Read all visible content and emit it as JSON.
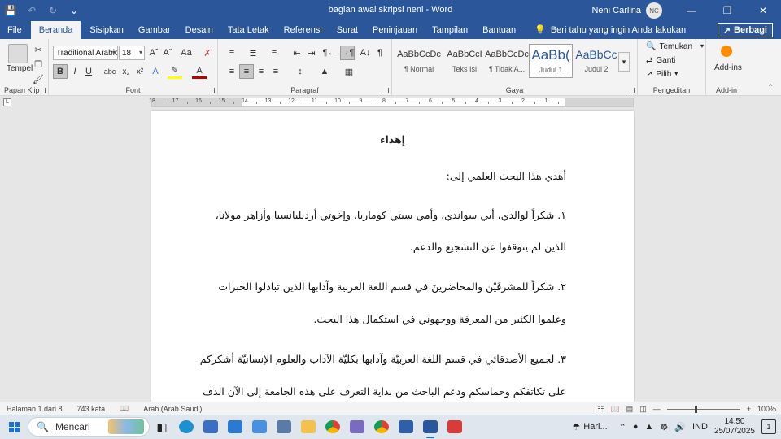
{
  "titlebar": {
    "doc_title": "bagian awal skripsi neni - Word",
    "user_name": "Neni Carlina",
    "avatar_initials": "NC"
  },
  "tabs": [
    "File",
    "Beranda",
    "Sisipkan",
    "Gambar",
    "Desain",
    "Tata Letak",
    "Referensi",
    "Surat",
    "Peninjauan",
    "Tampilan",
    "Bantuan"
  ],
  "tell_me": "Beri tahu yang ingin Anda lakukan",
  "share_label": "Berbagi",
  "ribbon": {
    "clipboard": {
      "paste_label": "Tempel",
      "group_label": "Papan Klip"
    },
    "font": {
      "font_name": "Traditional Arabic",
      "font_size": "18",
      "group_label": "Font"
    },
    "paragraph": {
      "group_label": "Paragraf"
    },
    "styles": {
      "group_label": "Gaya",
      "items": [
        {
          "sample": "AaBbCcDc",
          "name": "¶ Normal"
        },
        {
          "sample": "AaBbCcI",
          "name": "Teks Isi"
        },
        {
          "sample": "AaBbCcDc",
          "name": "¶ Tidak A..."
        },
        {
          "sample": "AaBb(",
          "name": "Judul 1"
        },
        {
          "sample": "AaBbCc",
          "name": "Judul 2"
        }
      ]
    },
    "editing": {
      "find": "Temukan",
      "replace": "Ganti",
      "select": "Pilih",
      "group_label": "Pengeditan"
    },
    "addins": {
      "label": "Add-ins",
      "group_label": "Add-in"
    }
  },
  "ruler": {
    "numbers": [
      "18",
      "17",
      "16",
      "15",
      "14",
      "13",
      "12",
      "11",
      "10",
      "9",
      "8",
      "7",
      "6",
      "5",
      "4",
      "3",
      "2",
      "1"
    ]
  },
  "document": {
    "heading": "إهداء",
    "intro": "أهدي هذا البحث العلمي إلى:",
    "lines": [
      "١. شكراً لوالدي، أبي سواندي، وأمي سيتي كوماريا، وإخوتي أرديليانسيا وأزاهر مولانا،",
      "الذين لم يتوقفوا عن التشجيع والدعم.",
      "٢. شكراً للمشرفَيْن والمحاضرينَ في قسم اللغة العربية وآدابها الذين تبادلوا الخبرات",
      "وعلموا الكثير من المعرفة ووجهوني في استكمال هذا البحث.",
      "٣. لجميع الأصدقائي في قسم اللغة العربيّة وآدابها بكليّة الآداب والعلوم الإنسانيّة أشكركم",
      "على تكاتفكم وحماسكم ودعم الباحث من بداية التعرف على هذه الجامعة إلى الآن الدف"
    ]
  },
  "statusbar": {
    "page": "Halaman 1 dari 8",
    "words": "743 kata",
    "language": "Arab (Arab Saudi)",
    "zoom": "100%"
  },
  "taskbar": {
    "search_placeholder": "Mencari",
    "weather": "Hari...",
    "ime": "IND",
    "time": "14.50",
    "date": "25/07/2025",
    "notifications": "1"
  }
}
